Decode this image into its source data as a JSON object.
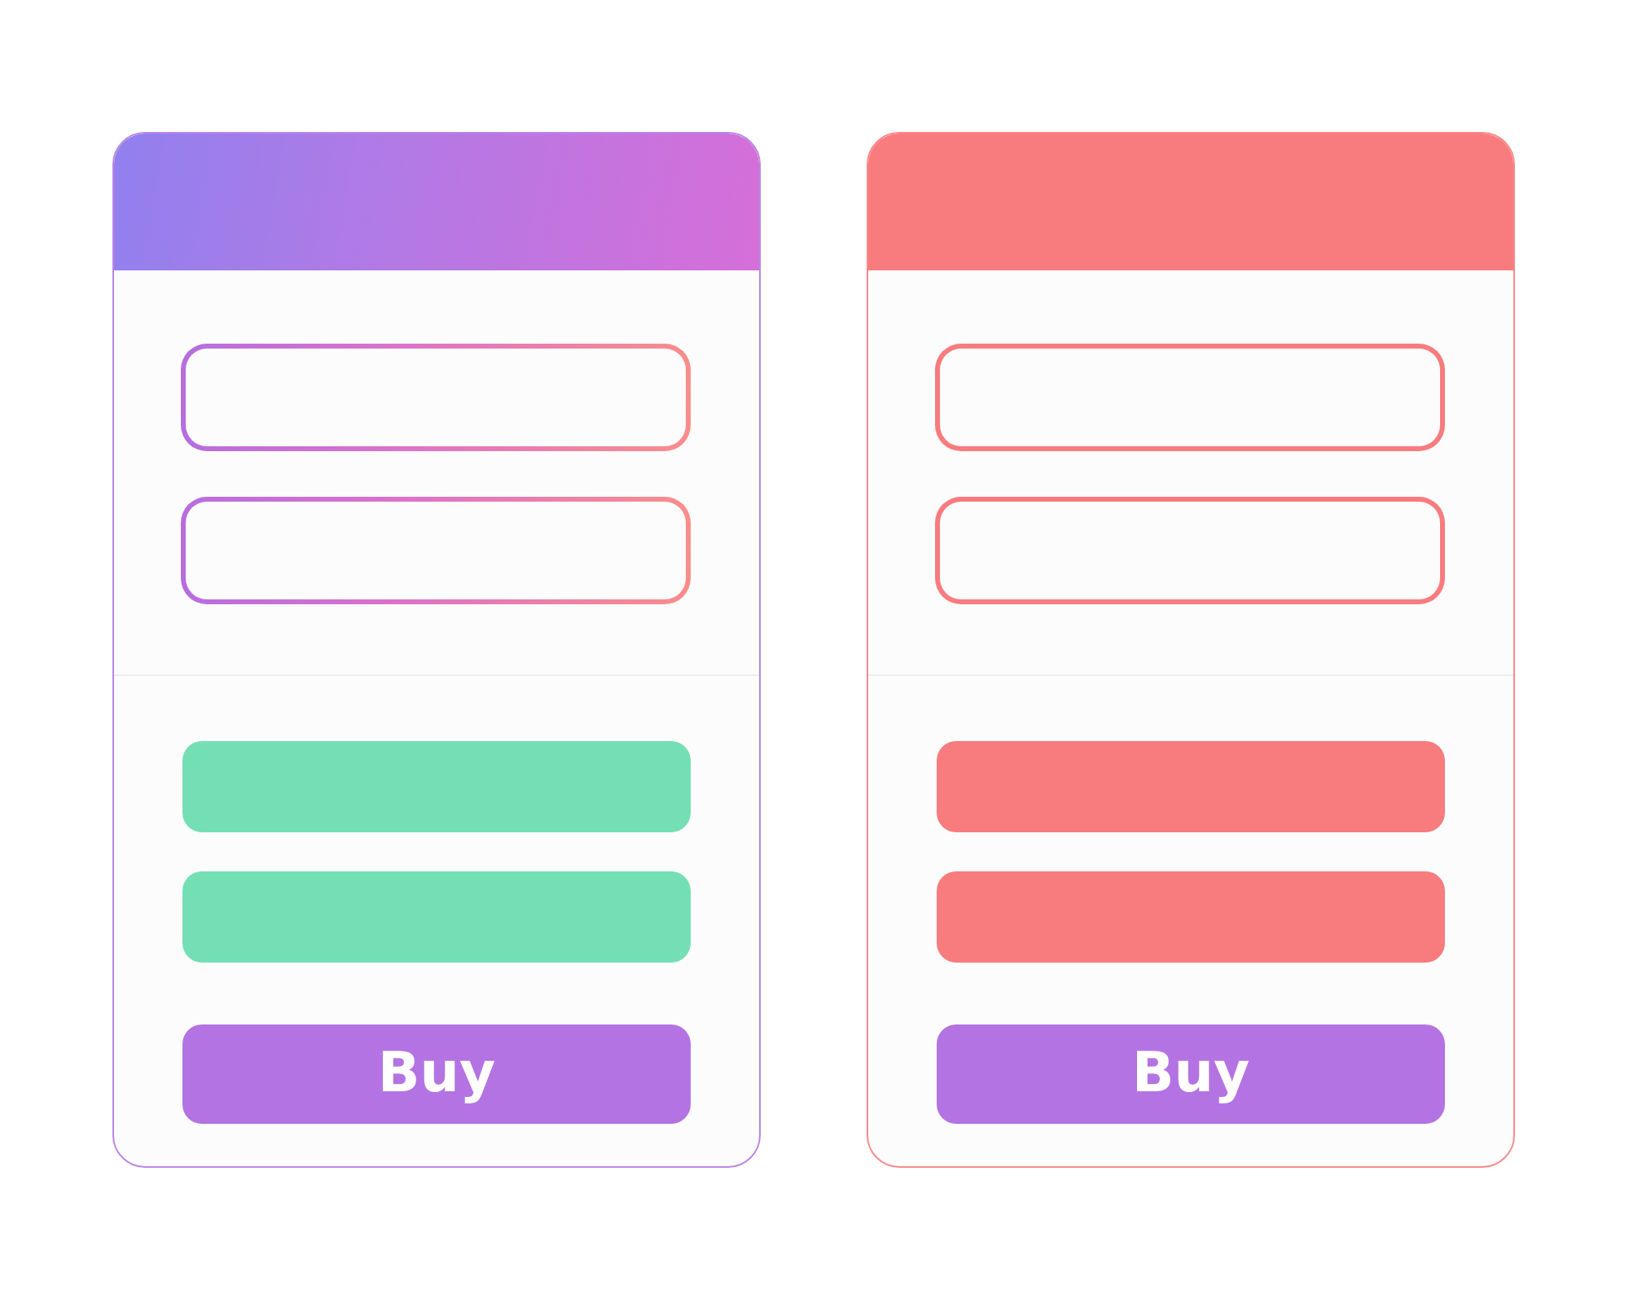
{
  "cards": [
    {
      "kind": "gradient",
      "fields": [
        {
          "kind": "input"
        },
        {
          "kind": "input"
        }
      ],
      "options": [
        {
          "kind": "bar"
        },
        {
          "kind": "bar"
        }
      ],
      "button": "Buy"
    },
    {
      "kind": "solid",
      "fields": [
        {
          "kind": "input"
        },
        {
          "kind": "input"
        }
      ],
      "options": [
        {
          "kind": "bar"
        },
        {
          "kind": "bar"
        }
      ],
      "button": "Buy"
    }
  ]
}
